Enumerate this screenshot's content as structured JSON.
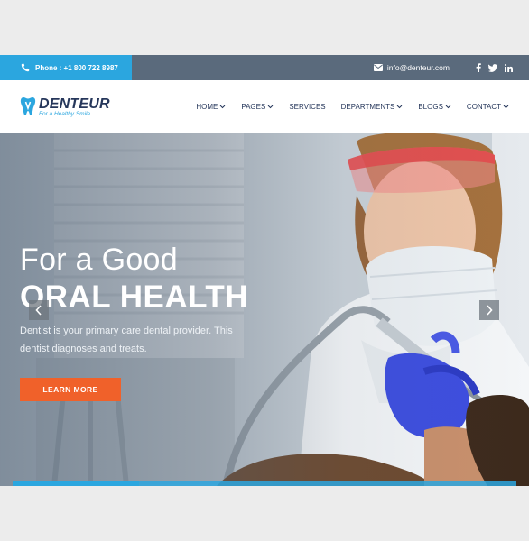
{
  "topbar": {
    "phone_text": "Phone : +1 800 722 8987",
    "email_text": "info@denteur.com",
    "social": [
      {
        "icon": "facebook-icon",
        "glyph": "f"
      },
      {
        "icon": "twitter-icon",
        "glyph": "t"
      },
      {
        "icon": "linkedin-icon",
        "glyph": "in"
      }
    ]
  },
  "brand": {
    "name": "DENTEUR",
    "tagline": "For a Healthy Smile"
  },
  "nav": {
    "items": [
      {
        "label": "HOME",
        "has_dropdown": true
      },
      {
        "label": "PAGES",
        "has_dropdown": true
      },
      {
        "label": "SERVICES",
        "has_dropdown": false
      },
      {
        "label": "DEPARTMENTS",
        "has_dropdown": true
      },
      {
        "label": "BLOGS",
        "has_dropdown": true
      },
      {
        "label": "CONTACT",
        "has_dropdown": true
      }
    ]
  },
  "hero": {
    "title_line1": "For a Good",
    "title_line2": "ORAL HEALTH",
    "description": "Dentist is your primary care dental provider. This dentist diagnoses and treats.",
    "button_label": "LEARN MORE",
    "slides": 4,
    "active_slide": 1
  },
  "colors": {
    "accent_blue": "#2ba6df",
    "topbar_slate": "#5a6a7c",
    "navy_text": "#26375b",
    "cta_orange": "#f0612a"
  }
}
